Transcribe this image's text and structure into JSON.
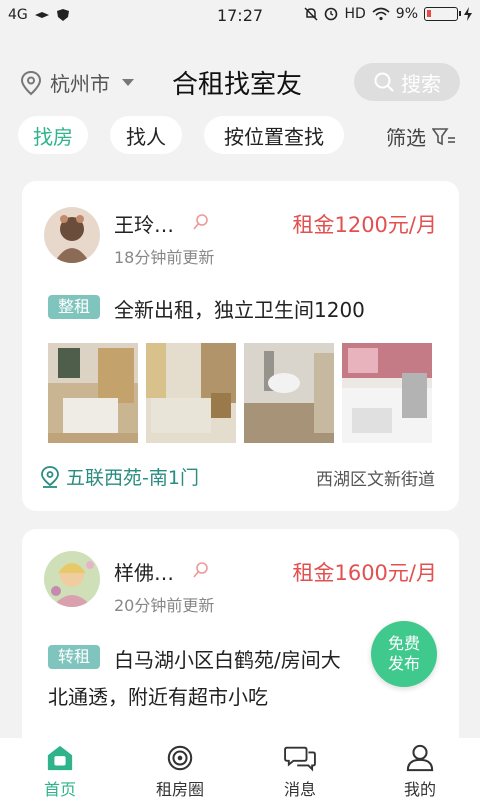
{
  "status_bar": {
    "network": "4G",
    "time": "17:27",
    "hd": "HD",
    "battery": "9%"
  },
  "header": {
    "city": "杭州市",
    "title": "合租找室友",
    "search_label": "搜索"
  },
  "filters": {
    "tabs": [
      {
        "label": "找房",
        "active": true
      },
      {
        "label": "找人",
        "active": false
      },
      {
        "label": "按位置查找",
        "active": false
      }
    ],
    "screen_label": "筛选"
  },
  "listings": [
    {
      "name": "王玲…",
      "updated": "18分钟前更新",
      "price": "租金1200元/月",
      "type": "整租",
      "description": "全新出租，独立卫生间1200",
      "location": "五联西苑-南1门",
      "district": "西湖区文新街道"
    },
    {
      "name": "样佛…",
      "updated": "20分钟前更新",
      "price": "租金1600元/月",
      "type": "转租",
      "description_line1": "白马湖小区白鹤苑/房间大",
      "description_line2": "北通透，附近有超市小吃"
    }
  ],
  "fab": {
    "line1": "免费",
    "line2": "发布"
  },
  "bottom_nav": [
    {
      "label": "首页",
      "icon": "home-icon",
      "active": true
    },
    {
      "label": "租房圈",
      "icon": "circle-icon",
      "active": false
    },
    {
      "label": "消息",
      "icon": "message-icon",
      "active": false
    },
    {
      "label": "我的",
      "icon": "profile-icon",
      "active": false
    }
  ],
  "colors": {
    "accent": "#2fb38a",
    "price": "#e25050",
    "badge": "#7fc4bd"
  }
}
